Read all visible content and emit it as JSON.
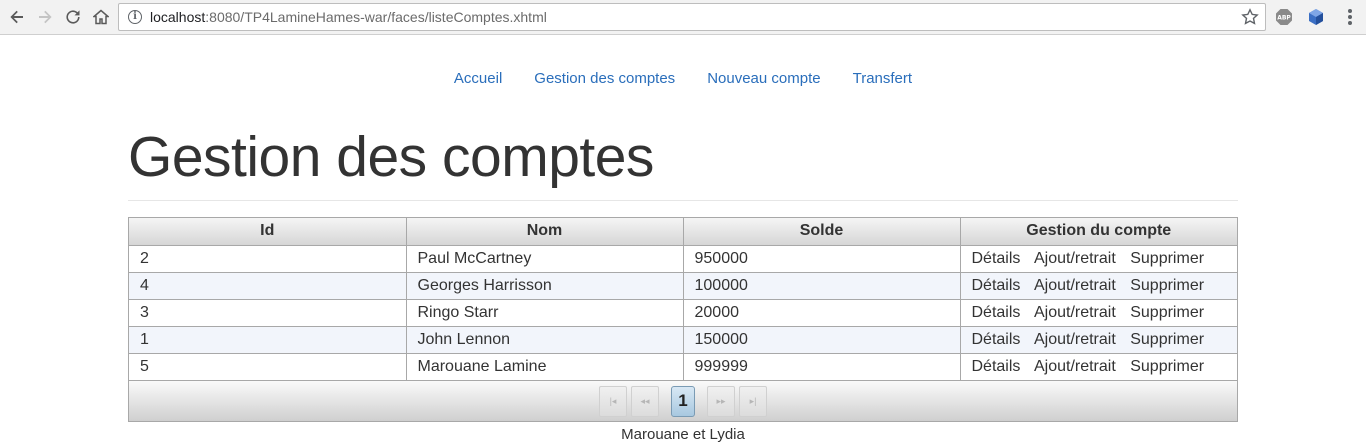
{
  "browser": {
    "url_host": "localhost",
    "url_rest": ":8080/TP4LamineHames-war/faces/listeComptes.xhtml",
    "extensions": [
      "adblock-icon",
      "extension-cube-icon"
    ]
  },
  "nav": {
    "items": [
      {
        "label": "Accueil"
      },
      {
        "label": "Gestion des comptes"
      },
      {
        "label": "Nouveau compte"
      },
      {
        "label": "Transfert"
      }
    ]
  },
  "page": {
    "title": "Gestion des comptes"
  },
  "table": {
    "headers": [
      "Id",
      "Nom",
      "Solde",
      "Gestion du compte"
    ],
    "rows": [
      {
        "id": "2",
        "nom": "Paul McCartney",
        "solde": "950000"
      },
      {
        "id": "4",
        "nom": "Georges Harrisson",
        "solde": "100000"
      },
      {
        "id": "3",
        "nom": "Ringo Starr",
        "solde": "20000"
      },
      {
        "id": "1",
        "nom": "John Lennon",
        "solde": "150000"
      },
      {
        "id": "5",
        "nom": "Marouane Lamine",
        "solde": "999999"
      }
    ],
    "actions": {
      "details": "Détails",
      "ajout": "Ajout/retrait",
      "supprimer": "Supprimer"
    }
  },
  "paginator": {
    "current_page": "1"
  },
  "footer": {
    "text": "Marouane et Lydia"
  },
  "colors": {
    "link": "#2a6ebb",
    "row_alt": "#f2f5fb",
    "page_active": "#a8c8e0"
  }
}
